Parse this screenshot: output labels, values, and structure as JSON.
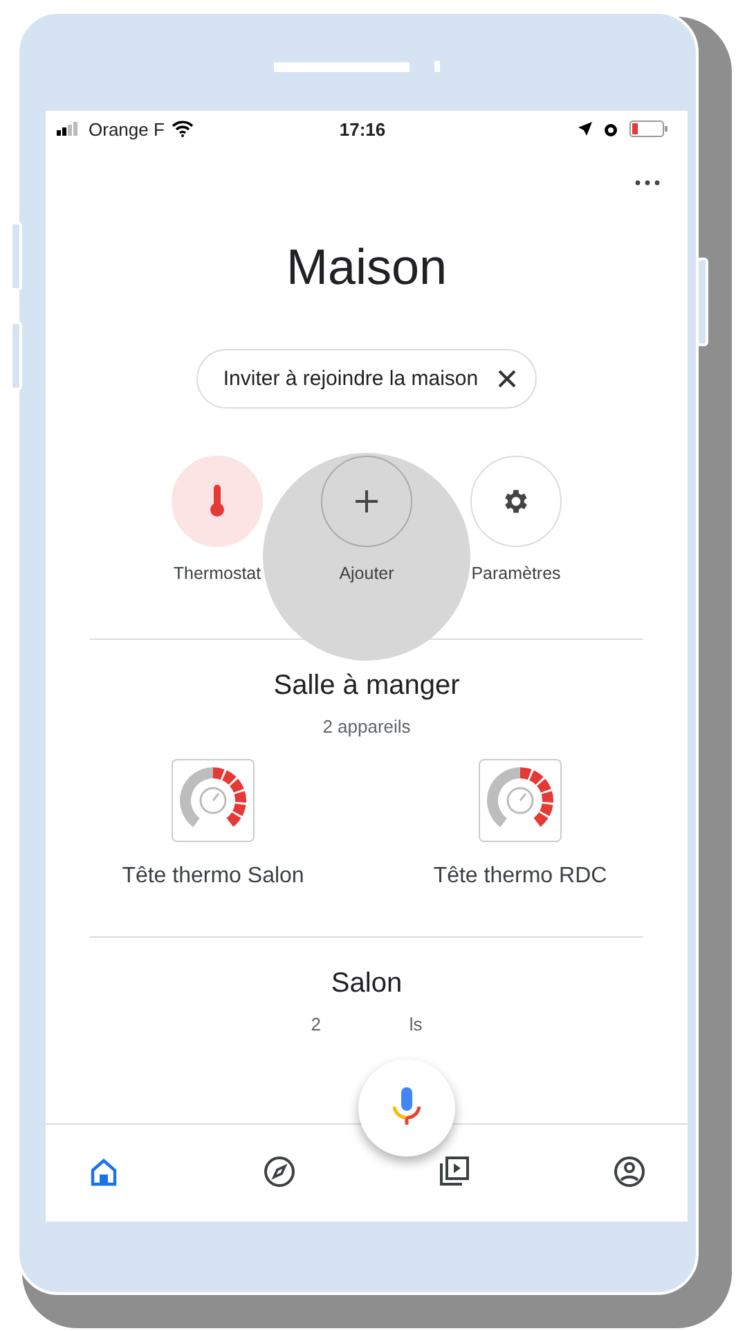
{
  "status_bar": {
    "carrier": "Orange F",
    "time": "17:16"
  },
  "title": "Maison",
  "invite_chip": {
    "label": "Inviter à rejoindre la maison"
  },
  "actions": [
    {
      "kind": "thermostat",
      "label": "Thermostat",
      "pressed": false
    },
    {
      "kind": "add",
      "label": "Ajouter",
      "pressed": true
    },
    {
      "kind": "settings",
      "label": "Paramètres",
      "pressed": false
    }
  ],
  "rooms": [
    {
      "name": "Salle à manger",
      "subtitle": "2 appareils",
      "devices": [
        {
          "name": "Tête thermo Salon"
        },
        {
          "name": "Tête thermo RDC"
        }
      ]
    },
    {
      "name": "Salon",
      "subtitle_visible_parts": [
        "2",
        "ls"
      ]
    }
  ],
  "nav": [
    {
      "kind": "home",
      "selected": true
    },
    {
      "kind": "discover",
      "selected": false
    },
    {
      "kind": "media",
      "selected": false
    },
    {
      "kind": "account",
      "selected": false
    }
  ]
}
